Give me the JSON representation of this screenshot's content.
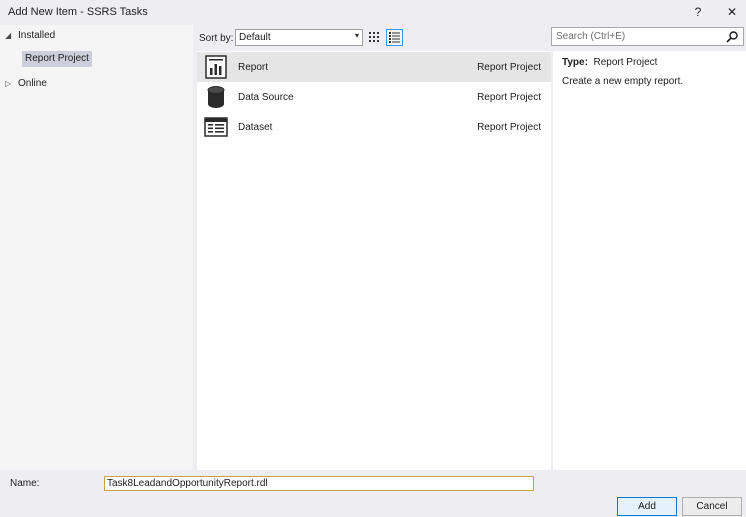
{
  "window": {
    "title": "Add New Item - SSRS Tasks",
    "help_label": "?",
    "close_label": "✕"
  },
  "tree": {
    "installed": {
      "arrow": "◢",
      "label": "Installed"
    },
    "selected_child": "Report Project",
    "online": {
      "arrow": "▷",
      "label": "Online"
    }
  },
  "sort": {
    "label": "Sort by:",
    "value": "Default",
    "caret": "▾"
  },
  "search": {
    "placeholder": "Search (Ctrl+E)"
  },
  "items": [
    {
      "name": "Report",
      "type": "Report Project",
      "icon": "report-icon",
      "selected": true
    },
    {
      "name": "Data Source",
      "type": "Report Project",
      "icon": "database-icon",
      "selected": false
    },
    {
      "name": "Dataset",
      "type": "Report Project",
      "icon": "dataset-icon",
      "selected": false
    }
  ],
  "details": {
    "type_key": "Type:",
    "type_value": "Report Project",
    "description": "Create a new empty report."
  },
  "footer": {
    "name_label": "Name:",
    "name_value": "Task8LeadandOpportunityReport.rdl",
    "add_label": "Add",
    "cancel_label": "Cancel"
  },
  "colors": {
    "selection": "#cccedb",
    "accent": "#0078d7",
    "input_border": "#c8a04a"
  }
}
